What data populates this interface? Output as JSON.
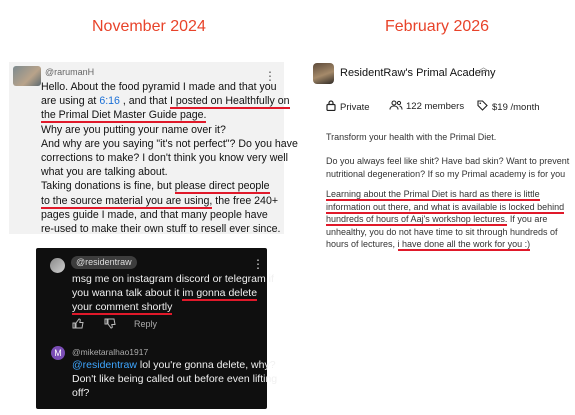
{
  "headers": {
    "left": "November 2024",
    "right": "February 2026"
  },
  "left_comment": {
    "username": "@rarumanH",
    "lines": [
      {
        "parts": [
          {
            "text": "Hello. About the food pyramid I made and that you"
          }
        ]
      },
      {
        "parts": [
          {
            "text": "are using at "
          },
          {
            "text": "6:16",
            "style": "ts"
          },
          {
            "text": " , and that "
          },
          {
            "text": "I posted on Healthfully on",
            "style": "ul"
          }
        ]
      },
      {
        "parts": [
          {
            "text": "the Primal Diet Master Guide page.",
            "style": "ul"
          }
        ]
      },
      {
        "parts": [
          {
            "text": "Why are you putting your name over it?"
          }
        ]
      },
      {
        "parts": [
          {
            "text": "And why are you saying \"it's not perfect\"? Do you have"
          }
        ]
      },
      {
        "parts": [
          {
            "text": "corrections to make? I don't think you know very well"
          }
        ]
      },
      {
        "parts": [
          {
            "text": "what you are talking about."
          }
        ]
      },
      {
        "parts": [
          {
            "text": "Taking donations is fine, but "
          },
          {
            "text": "please direct people",
            "style": "ul"
          }
        ]
      },
      {
        "parts": [
          {
            "text": "to the source material you are using,",
            "style": "ul"
          },
          {
            "text": " the free 240+"
          }
        ]
      },
      {
        "parts": [
          {
            "text": "pages guide I made, and that many people have"
          }
        ]
      },
      {
        "parts": [
          {
            "text": "re-used to make their own stuff to resell ever since."
          }
        ]
      }
    ]
  },
  "dark_thread": {
    "reply_username": "@residentraw",
    "reply_lines": [
      {
        "parts": [
          {
            "text": "msg me on instagram discord or telegram if"
          }
        ]
      },
      {
        "parts": [
          {
            "text": "you wanna talk about it "
          },
          {
            "text": "im gonna delete",
            "style": "ul"
          }
        ]
      },
      {
        "parts": [
          {
            "text": "your comment shortly",
            "style": "ul"
          }
        ]
      }
    ],
    "reply_action": "Reply",
    "second_avatar_letter": "M",
    "second_username": "@miketaralhao1917",
    "second_lines": [
      {
        "parts": [
          {
            "text": "@residentraw",
            "style": "mention"
          },
          {
            "text": " lol you're gonna delete, why?"
          }
        ]
      },
      {
        "parts": [
          {
            "text": "Don't like being called out before even lifting"
          }
        ]
      },
      {
        "parts": [
          {
            "text": "off?"
          }
        ]
      }
    ]
  },
  "community": {
    "name": "ResidentRaw's Primal Academy",
    "privacy": "Private",
    "members": "122 members",
    "price": "$19 /month",
    "tagline": "Transform your health with the Primal Diet.",
    "question_lines": [
      {
        "parts": [
          {
            "text": "Do you always feel like shit? Have bad skin? Want to prevent"
          }
        ]
      },
      {
        "parts": [
          {
            "text": "nutritional degeneration? If so my Primal academy is for you"
          }
        ]
      }
    ],
    "pitch_lines": [
      {
        "parts": [
          {
            "text": "Learning about the Primal Diet is hard as there is little",
            "style": "ul"
          }
        ]
      },
      {
        "parts": [
          {
            "text": "information out there, and what is available is locked behind",
            "style": "ul"
          }
        ]
      },
      {
        "parts": [
          {
            "text": "hundreds of hours of Aaj's workshop lectures.",
            "style": "ul"
          },
          {
            "text": " If you are"
          }
        ]
      },
      {
        "parts": [
          {
            "text": "unhealthy, you do not have time to sit through hundreds of"
          }
        ]
      },
      {
        "parts": [
          {
            "text": "hours of lectures, "
          },
          {
            "text": "i have done all the work for you :)",
            "style": "ul"
          }
        ]
      }
    ]
  },
  "icons": {
    "menu": "more-vert-icon",
    "like": "thumb-up-icon",
    "dislike": "thumb-down-icon",
    "lock": "lock-icon",
    "members": "people-icon",
    "price": "tag-icon",
    "switch": "unfold-icon"
  },
  "colors": {
    "header": "#e8432a",
    "underline": "#e0192a",
    "timestamp": "#1a6fd6",
    "mention": "#3ea6ff",
    "dark_bg": "#0f0f0f",
    "light_bg": "#f2f2f2"
  }
}
